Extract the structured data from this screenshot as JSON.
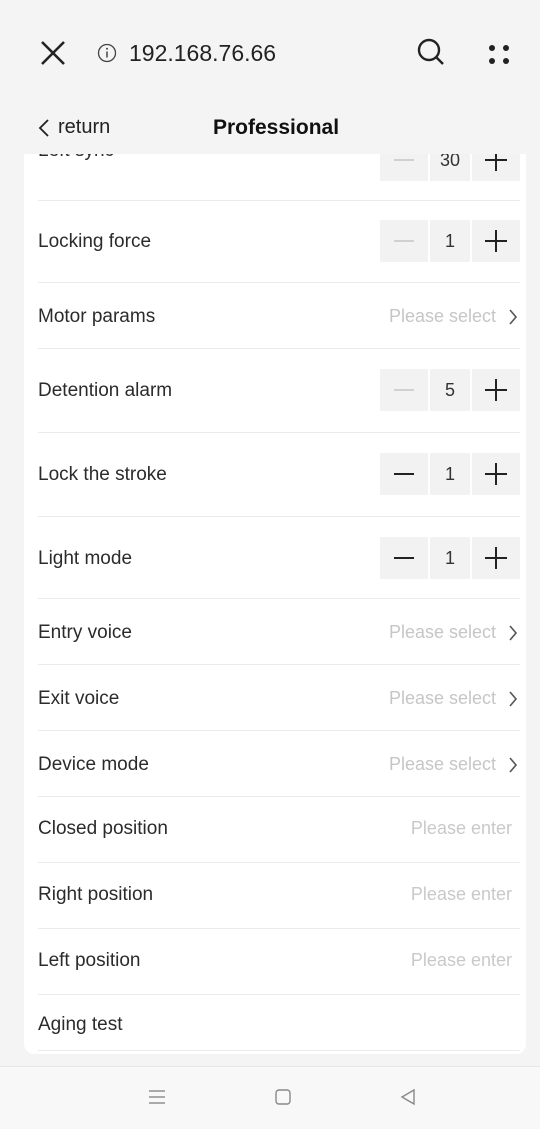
{
  "browser": {
    "url": "192.168.76.66"
  },
  "nav": {
    "back_label": "return",
    "title": "Professional"
  },
  "rows": [
    {
      "label": "Left sync",
      "value": "30"
    },
    {
      "label": "Locking force",
      "value": "1"
    },
    {
      "label": "Motor params",
      "value": "Please select"
    },
    {
      "label": "Detention alarm",
      "value": "5"
    },
    {
      "label": "Lock the stroke",
      "value": "1"
    },
    {
      "label": "Light mode",
      "value": "1"
    },
    {
      "label": "Entry voice",
      "value": "Please select"
    },
    {
      "label": "Exit voice",
      "value": "Please select"
    },
    {
      "label": "Device mode",
      "value": "Please select"
    },
    {
      "label": "Closed position",
      "value": "Please enter"
    },
    {
      "label": "Right position",
      "value": "Please enter"
    },
    {
      "label": "Left position",
      "value": "Please enter"
    },
    {
      "label": "Aging test",
      "value": ""
    }
  ],
  "colors": {
    "background": "#f4f4f4",
    "card": "#ffffff",
    "placeholder": "#c6c6c6",
    "stepper_bg": "#f2f2f2"
  },
  "icons": [
    "close-icon",
    "info-icon",
    "search-icon",
    "more-dots-icon",
    "chevron-left-icon",
    "chevron-right-icon",
    "minus-icon",
    "plus-icon",
    "menu-icon",
    "home-icon",
    "back-triangle-icon"
  ]
}
